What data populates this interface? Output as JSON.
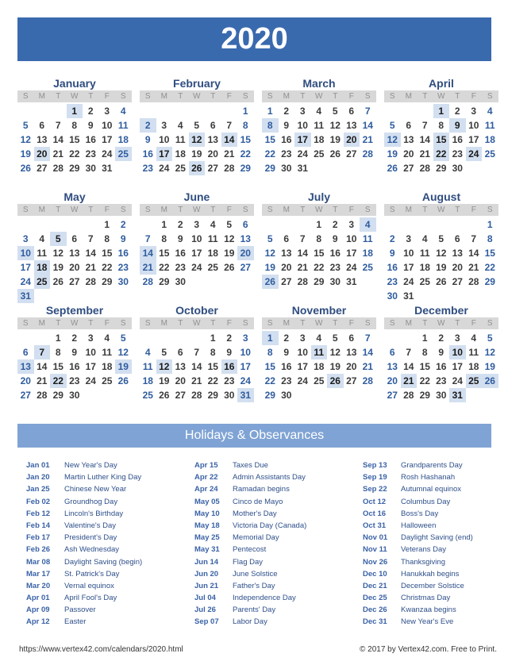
{
  "title": "2020",
  "dow": [
    "S",
    "M",
    "T",
    "W",
    "T",
    "F",
    "S"
  ],
  "months": [
    {
      "name": "January",
      "start": 3,
      "days": 31,
      "highlights": [
        1,
        20,
        25
      ]
    },
    {
      "name": "February",
      "start": 6,
      "days": 29,
      "highlights": [
        2,
        12,
        14,
        17,
        26
      ]
    },
    {
      "name": "March",
      "start": 0,
      "days": 31,
      "highlights": [
        8,
        17,
        20
      ]
    },
    {
      "name": "April",
      "start": 3,
      "days": 30,
      "highlights": [
        1,
        9,
        12,
        15,
        22,
        24
      ]
    },
    {
      "name": "May",
      "start": 5,
      "days": 31,
      "highlights": [
        5,
        10,
        18,
        25,
        31
      ]
    },
    {
      "name": "June",
      "start": 1,
      "days": 30,
      "highlights": [
        14,
        20,
        21
      ]
    },
    {
      "name": "July",
      "start": 3,
      "days": 31,
      "highlights": [
        4,
        26
      ]
    },
    {
      "name": "August",
      "start": 6,
      "days": 31,
      "highlights": []
    },
    {
      "name": "September",
      "start": 2,
      "days": 30,
      "highlights": [
        7,
        13,
        19,
        22
      ]
    },
    {
      "name": "October",
      "start": 4,
      "days": 31,
      "highlights": [
        12,
        16,
        31
      ]
    },
    {
      "name": "November",
      "start": 0,
      "days": 30,
      "highlights": [
        1,
        11,
        26
      ]
    },
    {
      "name": "December",
      "start": 2,
      "days": 31,
      "highlights": [
        10,
        21,
        25,
        26,
        31
      ]
    }
  ],
  "holidays_title": "Holidays & Observances",
  "holidays": [
    [
      {
        "date": "Jan 01",
        "name": "New Year's Day"
      },
      {
        "date": "Jan 20",
        "name": "Martin Luther King Day"
      },
      {
        "date": "Jan 25",
        "name": "Chinese New Year"
      },
      {
        "date": "Feb 02",
        "name": "Groundhog Day"
      },
      {
        "date": "Feb 12",
        "name": "Lincoln's Birthday"
      },
      {
        "date": "Feb 14",
        "name": "Valentine's Day"
      },
      {
        "date": "Feb 17",
        "name": "President's Day"
      },
      {
        "date": "Feb 26",
        "name": "Ash Wednesday"
      },
      {
        "date": "Mar 08",
        "name": "Daylight Saving (begin)"
      },
      {
        "date": "Mar 17",
        "name": "St. Patrick's Day"
      },
      {
        "date": "Mar 20",
        "name": "Vernal equinox"
      },
      {
        "date": "Apr 01",
        "name": "April Fool's Day"
      },
      {
        "date": "Apr 09",
        "name": "Passover"
      },
      {
        "date": "Apr 12",
        "name": "Easter"
      }
    ],
    [
      {
        "date": "Apr 15",
        "name": "Taxes Due"
      },
      {
        "date": "Apr 22",
        "name": "Admin Assistants Day"
      },
      {
        "date": "Apr 24",
        "name": "Ramadan begins"
      },
      {
        "date": "May 05",
        "name": "Cinco de Mayo"
      },
      {
        "date": "May 10",
        "name": "Mother's Day"
      },
      {
        "date": "May 18",
        "name": "Victoria Day (Canada)"
      },
      {
        "date": "May 25",
        "name": "Memorial Day"
      },
      {
        "date": "May 31",
        "name": "Pentecost"
      },
      {
        "date": "Jun 14",
        "name": "Flag Day"
      },
      {
        "date": "Jun 20",
        "name": "June Solstice"
      },
      {
        "date": "Jun 21",
        "name": "Father's Day"
      },
      {
        "date": "Jul 04",
        "name": "Independence Day"
      },
      {
        "date": "Jul 26",
        "name": "Parents' Day"
      },
      {
        "date": "Sep 07",
        "name": "Labor Day"
      }
    ],
    [
      {
        "date": "Sep 13",
        "name": "Grandparents Day"
      },
      {
        "date": "Sep 19",
        "name": "Rosh Hashanah"
      },
      {
        "date": "Sep 22",
        "name": "Autumnal equinox"
      },
      {
        "date": "Oct 12",
        "name": "Columbus Day"
      },
      {
        "date": "Oct 16",
        "name": "Boss's Day"
      },
      {
        "date": "Oct 31",
        "name": "Halloween"
      },
      {
        "date": "Nov 01",
        "name": "Daylight Saving (end)"
      },
      {
        "date": "Nov 11",
        "name": "Veterans Day"
      },
      {
        "date": "Nov 26",
        "name": "Thanksgiving"
      },
      {
        "date": "Dec 10",
        "name": "Hanukkah begins"
      },
      {
        "date": "Dec 21",
        "name": "December Solstice"
      },
      {
        "date": "Dec 25",
        "name": "Christmas Day"
      },
      {
        "date": "Dec 26",
        "name": "Kwanzaa begins"
      },
      {
        "date": "Dec 31",
        "name": "New Year's Eve"
      }
    ]
  ],
  "footer": {
    "url": "https://www.vertex42.com/calendars/2020.html",
    "copyright": "© 2017 by Vertex42.com. Free to Print."
  }
}
